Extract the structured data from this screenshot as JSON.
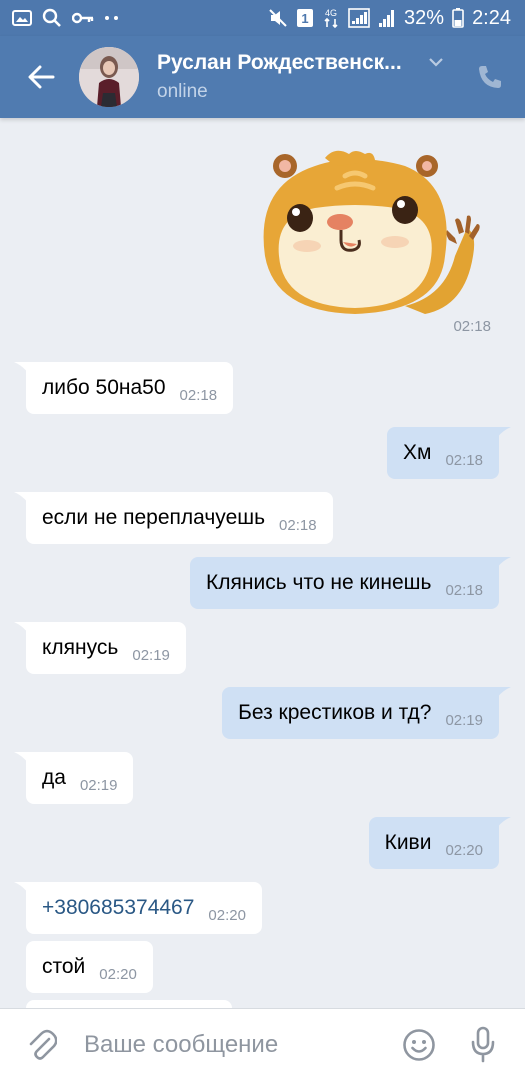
{
  "status_bar": {
    "battery": "32%",
    "time": "2:24",
    "network": "4G",
    "sim_slot": "1"
  },
  "header": {
    "contact_name": "Руслан Рождественск...",
    "contact_status": "online"
  },
  "messages": {
    "sticker_time": "02:18",
    "items": [
      {
        "direction": "in",
        "text": "либо 50на50",
        "time": "02:18"
      },
      {
        "direction": "out",
        "text": "Хм",
        "time": "02:18"
      },
      {
        "direction": "in",
        "text": "если не переплачуешь",
        "time": "02:18"
      },
      {
        "direction": "out",
        "text": "Клянись что не кинешь",
        "time": "02:18"
      },
      {
        "direction": "in",
        "text": "клянусь",
        "time": "02:19"
      },
      {
        "direction": "out",
        "text": "Без крестиков и тд?",
        "time": "02:19"
      },
      {
        "direction": "in",
        "text": "да",
        "time": "02:19"
      },
      {
        "direction": "out",
        "text": "Киви",
        "time": "02:20"
      },
      {
        "direction": "in",
        "text": "+380685374467",
        "time": "02:20"
      },
      {
        "direction": "in",
        "text": "стой",
        "time": "02:20"
      }
    ]
  },
  "input": {
    "placeholder": "Ваше сообщение"
  },
  "colors": {
    "header_bg": "#507bb0",
    "chat_bg": "#ebeef3",
    "incoming_bubble": "#ffffff",
    "outgoing_bubble": "#cfe0f4",
    "link": "#2a5885"
  }
}
